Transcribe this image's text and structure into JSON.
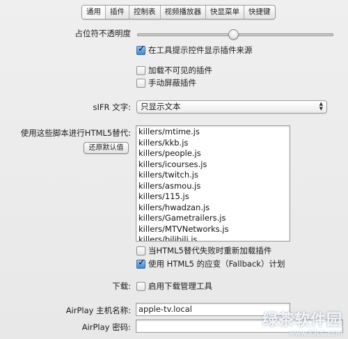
{
  "tabs": [
    {
      "label": "通用",
      "active": true
    },
    {
      "label": "插件"
    },
    {
      "label": "控制表"
    },
    {
      "label": "视频播放器"
    },
    {
      "label": "快显菜单"
    },
    {
      "label": "快捷键"
    }
  ],
  "opacity": {
    "label": "占位符不透明度",
    "value_fraction": 0.49
  },
  "show_source_checkbox": {
    "label": "在工具提示控件显示插件来源",
    "checked": true
  },
  "load_invisible_checkbox": {
    "label": "加载不可见的插件",
    "checked": false
  },
  "manual_block_checkbox": {
    "label": "手动屏蔽插件",
    "checked": false
  },
  "sifr": {
    "label": "sIFR 文字:",
    "selected": "只显示文本"
  },
  "html5_scripts": {
    "label": "使用这些脚本进行HTML5替代:",
    "restore_button": "还原默认值",
    "items": [
      "killers/mtime.js",
      "killers/kkb.js",
      "killers/people.js",
      "killers/icourses.js",
      "killers/twitch.js",
      "killers/asmou.js",
      "killers/115.js",
      "killers/hwadzan.js",
      "killers/Gametrailers.js",
      "killers/MTVNetworks.js",
      "killers/bilibili.js"
    ]
  },
  "reload_on_fail_checkbox": {
    "label": "当HTML5替代失败时重新加载插件",
    "checked": false
  },
  "fallback_checkbox": {
    "label": "使用 HTML5 的应变（Fallback）计划",
    "checked": true
  },
  "download": {
    "label": "下载:",
    "checkbox_label": "启用下载管理工具",
    "checked": false
  },
  "airplay_host": {
    "label": "AirPlay 主机名称:",
    "value": "apple-tv.local"
  },
  "airplay_password": {
    "label": "AirPlay 密码:",
    "value": ""
  },
  "watermark": {
    "line1": "绿茶软件园",
    "line2": "www.33LC.com"
  },
  "colors": {
    "window_bg": "#ececec",
    "checkbox_checked": "#3f86d6"
  }
}
